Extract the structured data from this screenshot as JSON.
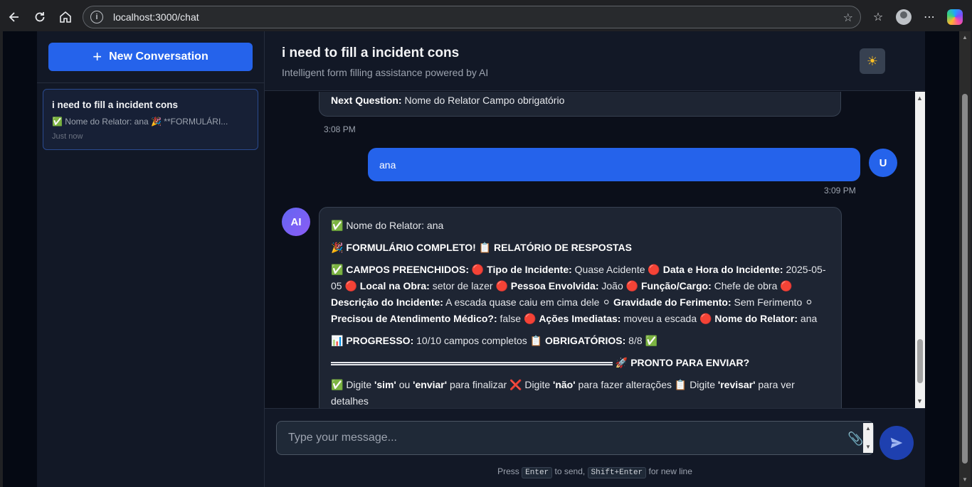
{
  "browser": {
    "url": "localhost:3000/chat"
  },
  "sidebar": {
    "new_conversation_label": "New Conversation",
    "conversations": [
      {
        "title": "i need to fill a incident cons",
        "preview": "✅ Nome do Relator: ana 🎉 **FORMULÁRI...",
        "time": "Just now"
      }
    ]
  },
  "header": {
    "title": "i need to fill a incident cons",
    "subtitle": "Intelligent form filling assistance powered by AI"
  },
  "messages": {
    "prev_ai": {
      "label": "Next Question:",
      "text": "Nome do Relator Campo obrigatório",
      "time": "3:08 PM"
    },
    "user": {
      "avatar": "U",
      "text": "ana",
      "time": "3:09 PM"
    },
    "ai": {
      "avatar": "AI",
      "line1": "✅ Nome do Relator: ana",
      "line2_prefix": "🎉 ",
      "line2": "FORMULÁRIO COMPLETO! 📋 RELATÓRIO DE RESPOSTAS",
      "campos": {
        "prefix": "✅ ",
        "heading": "CAMPOS PREENCHIDOS:",
        "marker_red": "🔴",
        "marker_white": "⚪",
        "f1_label": "Tipo de Incidente:",
        "f1_value": "Quase Acidente",
        "f2_label": "Data e Hora do Incidente:",
        "f2_value": "2025-05-05",
        "f3_label": "Local na Obra:",
        "f3_value": "setor de lazer",
        "f4_label": "Pessoa Envolvida:",
        "f4_value": "João",
        "f5_label": "Função/Cargo:",
        "f5_value": "Chefe de obra",
        "f6_label": "Descrição do Incidente:",
        "f6_value": "A escada quase caiu em cima dele",
        "f7_label": "Gravidade do Ferimento:",
        "f7_value": "Sem Ferimento",
        "f8_label": "Precisou de Atendimento Médico?:",
        "f8_value": "false",
        "f9_label": "Ações Imediatas:",
        "f9_value": "moveu a escada",
        "f10_label": "Nome do Relator:",
        "f10_value": "ana"
      },
      "progress": {
        "prefix": "📊 ",
        "label": "PROGRESSO:",
        "value": "10/10 campos completos",
        "req_prefix": "📋 ",
        "req_label": "OBRIGATÓRIOS:",
        "req_value": "8/8 ✅"
      },
      "ready": {
        "prefix": "🚀 ",
        "label": "PRONTO PARA ENVIAR?"
      },
      "instructions": {
        "p1": "✅ Digite ",
        "sim": "'sim'",
        "ou": " ou ",
        "enviar": "'enviar'",
        "p2": " para finalizar ❌ Digite ",
        "nao": "'não'",
        "p3": " para fazer alterações 📋 Digite ",
        "revisar": "'revisar'",
        "p4": " para ver detalhes"
      }
    }
  },
  "composer": {
    "placeholder": "Type your message...",
    "hint_press": "Press",
    "hint_enter": "Enter",
    "hint_to_send": "to send,",
    "hint_shift_enter": "Shift+Enter",
    "hint_new_line": "for new line"
  },
  "colors": {
    "accent": "#2563eb",
    "background": "#0b0f1a",
    "panel": "#121826",
    "bubble": "#1e2533"
  }
}
